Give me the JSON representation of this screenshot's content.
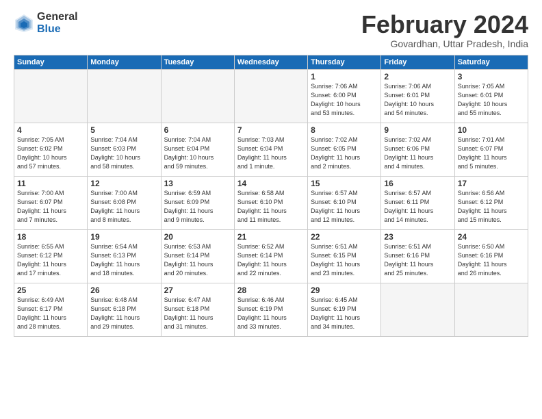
{
  "logo": {
    "general": "General",
    "blue": "Blue"
  },
  "title": "February 2024",
  "subtitle": "Govardhan, Uttar Pradesh, India",
  "days_header": [
    "Sunday",
    "Monday",
    "Tuesday",
    "Wednesday",
    "Thursday",
    "Friday",
    "Saturday"
  ],
  "weeks": [
    [
      {
        "num": "",
        "info": ""
      },
      {
        "num": "",
        "info": ""
      },
      {
        "num": "",
        "info": ""
      },
      {
        "num": "",
        "info": ""
      },
      {
        "num": "1",
        "info": "Sunrise: 7:06 AM\nSunset: 6:00 PM\nDaylight: 10 hours\nand 53 minutes."
      },
      {
        "num": "2",
        "info": "Sunrise: 7:06 AM\nSunset: 6:01 PM\nDaylight: 10 hours\nand 54 minutes."
      },
      {
        "num": "3",
        "info": "Sunrise: 7:05 AM\nSunset: 6:01 PM\nDaylight: 10 hours\nand 55 minutes."
      }
    ],
    [
      {
        "num": "4",
        "info": "Sunrise: 7:05 AM\nSunset: 6:02 PM\nDaylight: 10 hours\nand 57 minutes."
      },
      {
        "num": "5",
        "info": "Sunrise: 7:04 AM\nSunset: 6:03 PM\nDaylight: 10 hours\nand 58 minutes."
      },
      {
        "num": "6",
        "info": "Sunrise: 7:04 AM\nSunset: 6:04 PM\nDaylight: 10 hours\nand 59 minutes."
      },
      {
        "num": "7",
        "info": "Sunrise: 7:03 AM\nSunset: 6:04 PM\nDaylight: 11 hours\nand 1 minute."
      },
      {
        "num": "8",
        "info": "Sunrise: 7:02 AM\nSunset: 6:05 PM\nDaylight: 11 hours\nand 2 minutes."
      },
      {
        "num": "9",
        "info": "Sunrise: 7:02 AM\nSunset: 6:06 PM\nDaylight: 11 hours\nand 4 minutes."
      },
      {
        "num": "10",
        "info": "Sunrise: 7:01 AM\nSunset: 6:07 PM\nDaylight: 11 hours\nand 5 minutes."
      }
    ],
    [
      {
        "num": "11",
        "info": "Sunrise: 7:00 AM\nSunset: 6:07 PM\nDaylight: 11 hours\nand 7 minutes."
      },
      {
        "num": "12",
        "info": "Sunrise: 7:00 AM\nSunset: 6:08 PM\nDaylight: 11 hours\nand 8 minutes."
      },
      {
        "num": "13",
        "info": "Sunrise: 6:59 AM\nSunset: 6:09 PM\nDaylight: 11 hours\nand 9 minutes."
      },
      {
        "num": "14",
        "info": "Sunrise: 6:58 AM\nSunset: 6:10 PM\nDaylight: 11 hours\nand 11 minutes."
      },
      {
        "num": "15",
        "info": "Sunrise: 6:57 AM\nSunset: 6:10 PM\nDaylight: 11 hours\nand 12 minutes."
      },
      {
        "num": "16",
        "info": "Sunrise: 6:57 AM\nSunset: 6:11 PM\nDaylight: 11 hours\nand 14 minutes."
      },
      {
        "num": "17",
        "info": "Sunrise: 6:56 AM\nSunset: 6:12 PM\nDaylight: 11 hours\nand 15 minutes."
      }
    ],
    [
      {
        "num": "18",
        "info": "Sunrise: 6:55 AM\nSunset: 6:12 PM\nDaylight: 11 hours\nand 17 minutes."
      },
      {
        "num": "19",
        "info": "Sunrise: 6:54 AM\nSunset: 6:13 PM\nDaylight: 11 hours\nand 18 minutes."
      },
      {
        "num": "20",
        "info": "Sunrise: 6:53 AM\nSunset: 6:14 PM\nDaylight: 11 hours\nand 20 minutes."
      },
      {
        "num": "21",
        "info": "Sunrise: 6:52 AM\nSunset: 6:14 PM\nDaylight: 11 hours\nand 22 minutes."
      },
      {
        "num": "22",
        "info": "Sunrise: 6:51 AM\nSunset: 6:15 PM\nDaylight: 11 hours\nand 23 minutes."
      },
      {
        "num": "23",
        "info": "Sunrise: 6:51 AM\nSunset: 6:16 PM\nDaylight: 11 hours\nand 25 minutes."
      },
      {
        "num": "24",
        "info": "Sunrise: 6:50 AM\nSunset: 6:16 PM\nDaylight: 11 hours\nand 26 minutes."
      }
    ],
    [
      {
        "num": "25",
        "info": "Sunrise: 6:49 AM\nSunset: 6:17 PM\nDaylight: 11 hours\nand 28 minutes."
      },
      {
        "num": "26",
        "info": "Sunrise: 6:48 AM\nSunset: 6:18 PM\nDaylight: 11 hours\nand 29 minutes."
      },
      {
        "num": "27",
        "info": "Sunrise: 6:47 AM\nSunset: 6:18 PM\nDaylight: 11 hours\nand 31 minutes."
      },
      {
        "num": "28",
        "info": "Sunrise: 6:46 AM\nSunset: 6:19 PM\nDaylight: 11 hours\nand 33 minutes."
      },
      {
        "num": "29",
        "info": "Sunrise: 6:45 AM\nSunset: 6:19 PM\nDaylight: 11 hours\nand 34 minutes."
      },
      {
        "num": "",
        "info": ""
      },
      {
        "num": "",
        "info": ""
      }
    ]
  ]
}
